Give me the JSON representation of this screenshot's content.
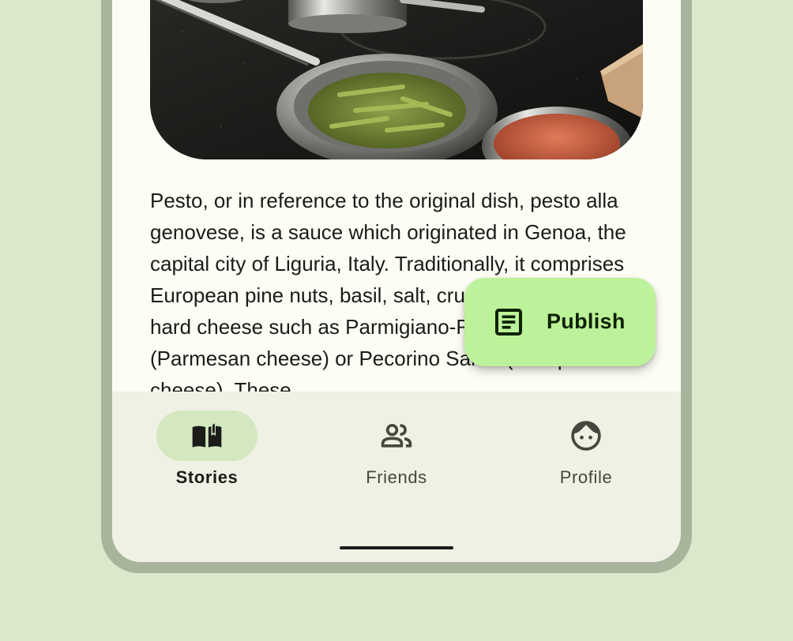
{
  "article": {
    "body": "Pesto, or in reference to the original dish, pesto alla genovese, is a sauce which originated in Genoa, the capital city of Liguria, Italy. Traditionally, it comprises European pine nuts, basil, salt, crushed garlic, and hard cheese such as Parmigiano-Reggiano (Parmesan cheese) or Pecorino Sardo (sheep's milk cheese). These"
  },
  "fab": {
    "label": "Publish",
    "icon": "article-icon"
  },
  "nav": {
    "items": [
      {
        "label": "Stories",
        "icon": "book-open-icon",
        "selected": true
      },
      {
        "label": "Friends",
        "icon": "people-icon",
        "selected": false
      },
      {
        "label": "Profile",
        "icon": "face-icon",
        "selected": false
      }
    ]
  },
  "colors": {
    "background": "#dce8cc",
    "frame": "#a8b59c",
    "surface": "#fdfdf5",
    "nav_surface": "#eef1e3",
    "nav_pill": "#d3e8c0",
    "fab": "#bcf29a"
  }
}
